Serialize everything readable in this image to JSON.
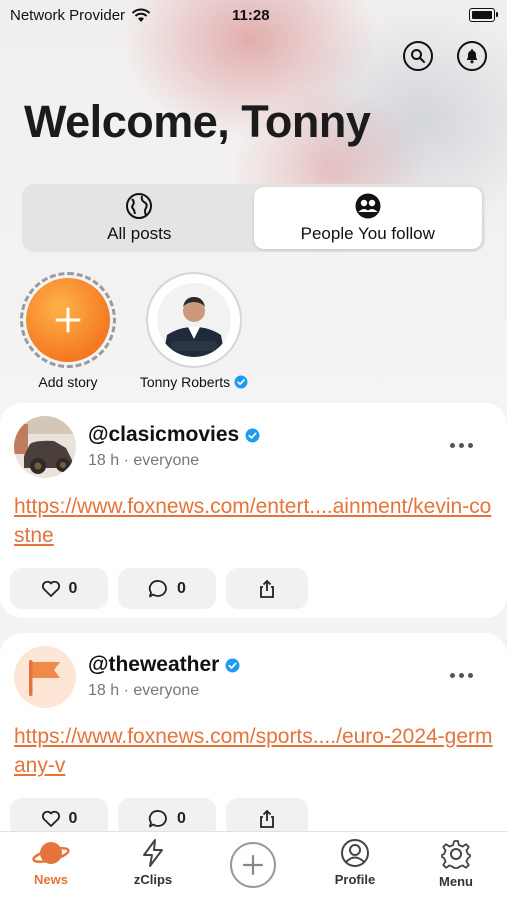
{
  "status_bar": {
    "carrier": "Network Provider",
    "time": "11:28"
  },
  "header": {
    "welcome": "Welcome, Tonny"
  },
  "feed_tabs": [
    {
      "label": "All posts",
      "icon": "globe-icon",
      "active": false
    },
    {
      "label": "People You follow",
      "icon": "people-icon",
      "active": true
    }
  ],
  "stories": [
    {
      "label": "Add story"
    },
    {
      "label": "Tonny Roberts",
      "verified": true
    }
  ],
  "posts": [
    {
      "handle": "@clasicmovies",
      "verified": true,
      "time": "18 h",
      "audience": "everyone",
      "link": "https://www.foxnews.com/entert....ainment/kevin-costne",
      "likes": "0",
      "comments": "0"
    },
    {
      "handle": "@theweather",
      "verified": true,
      "time": "18 h",
      "audience": "everyone",
      "link": "https://www.foxnews.com/sports..../euro-2024-germany-v",
      "likes": "0",
      "comments": "0"
    }
  ],
  "tabbar": {
    "items": [
      {
        "label": "News",
        "active": true
      },
      {
        "label": "zClips"
      },
      {
        "label": "Profile"
      },
      {
        "label": "Menu"
      }
    ]
  },
  "colors": {
    "accent": "#e5733a",
    "verified": "#1d9bf0"
  }
}
